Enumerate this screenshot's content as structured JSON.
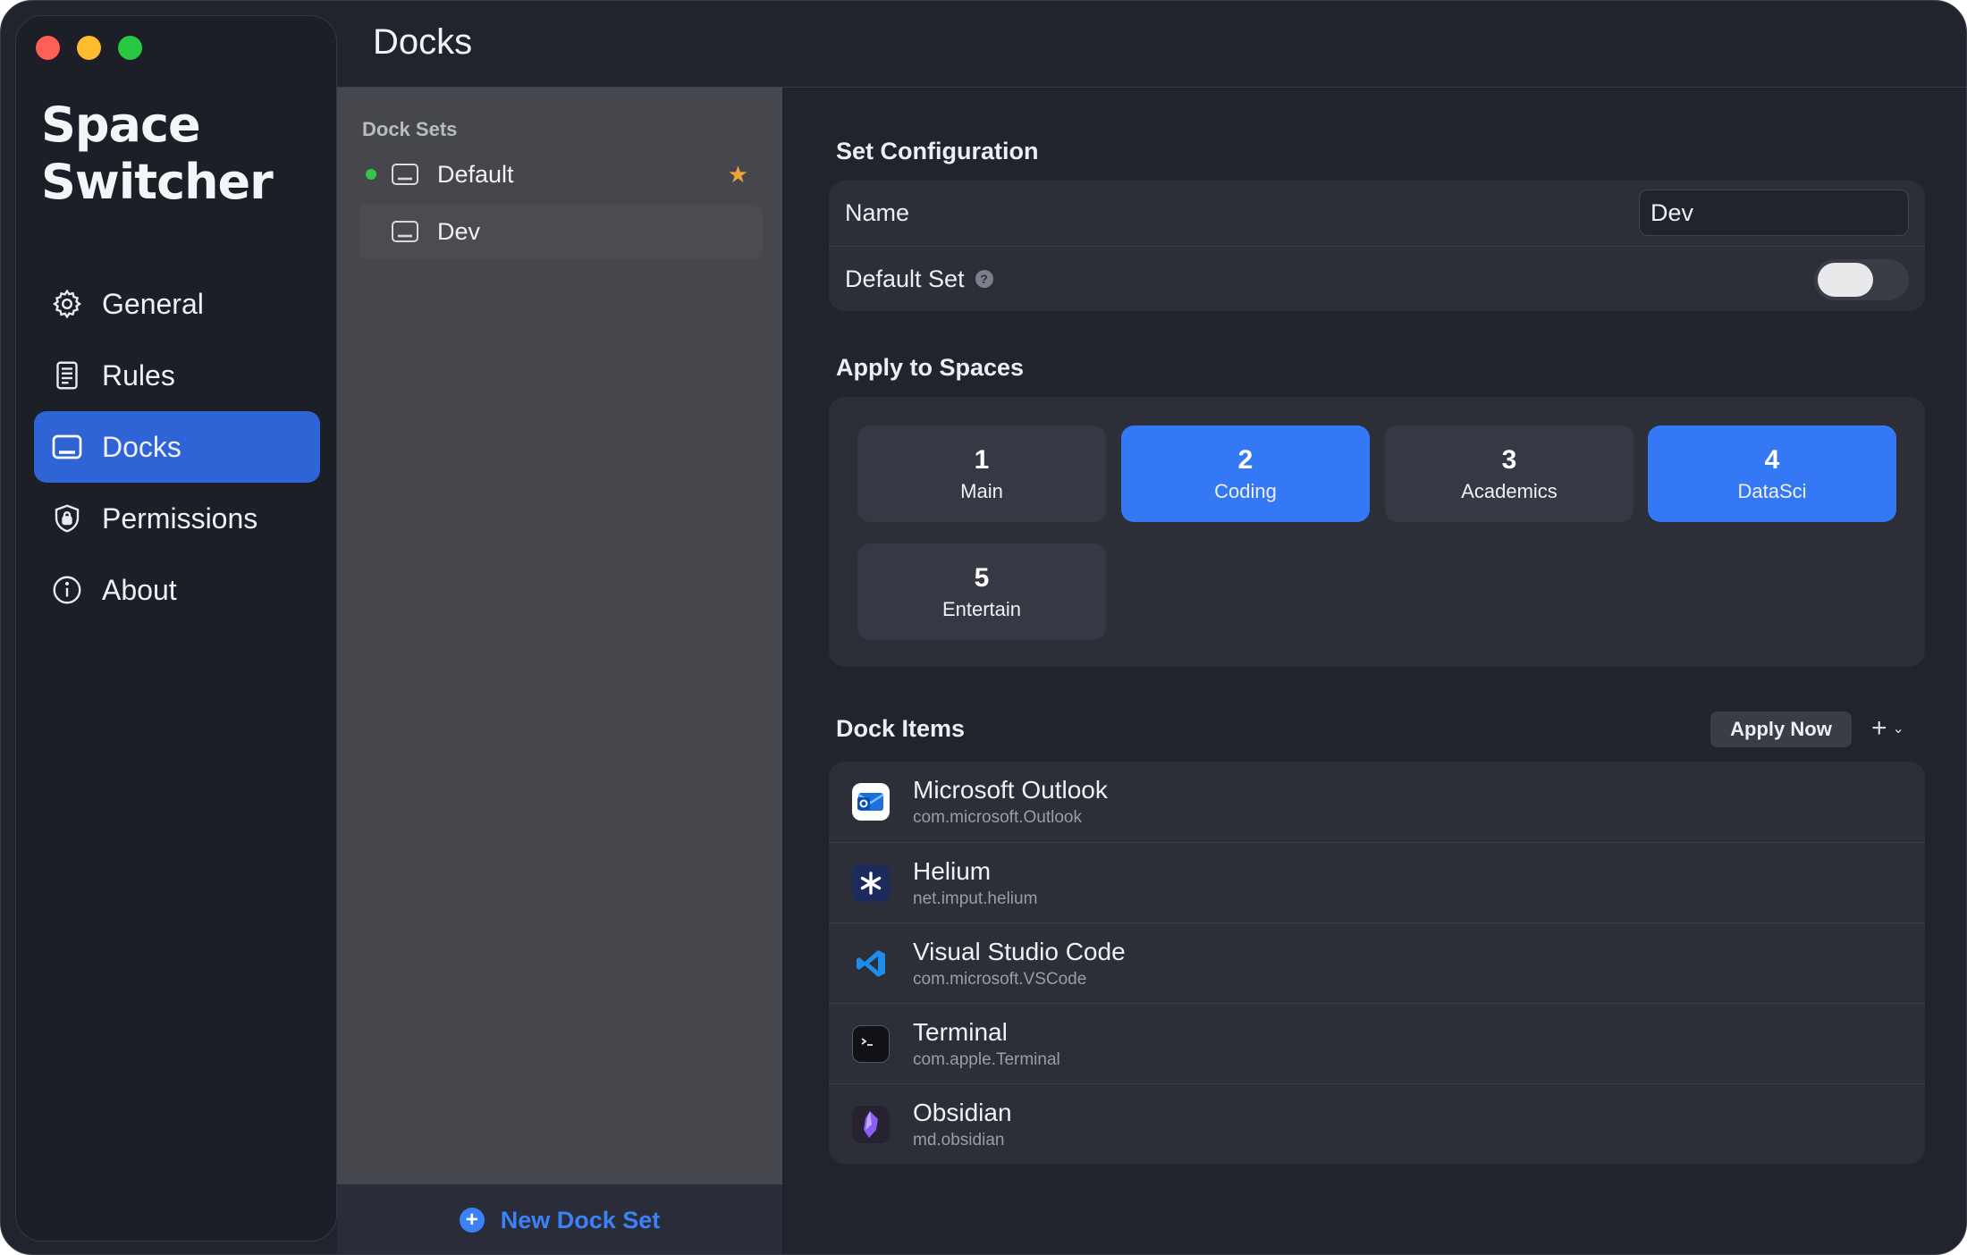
{
  "app": {
    "title": "Space Switcher",
    "title_line1": "Space",
    "title_line2": "Switcher"
  },
  "sidebar": {
    "items": [
      {
        "label": "General",
        "icon": "gear-icon",
        "active": false
      },
      {
        "label": "Rules",
        "icon": "document-icon",
        "active": false
      },
      {
        "label": "Docks",
        "icon": "dock-icon",
        "active": true
      },
      {
        "label": "Permissions",
        "icon": "shield-lock-icon",
        "active": false
      },
      {
        "label": "About",
        "icon": "info-icon",
        "active": false
      }
    ]
  },
  "header": {
    "title": "Docks"
  },
  "dock_sets": {
    "heading": "Dock Sets",
    "items": [
      {
        "label": "Default",
        "active_indicator": true,
        "is_default": true
      },
      {
        "label": "Dev",
        "active_indicator": false,
        "is_default": false,
        "selected": true
      }
    ],
    "new_button_label": "New Dock Set"
  },
  "config": {
    "section_title": "Set Configuration",
    "name_label": "Name",
    "name_value": "Dev",
    "default_label": "Default Set",
    "help_glyph": "?",
    "default_on": false
  },
  "spaces": {
    "section_title": "Apply to Spaces",
    "tiles": [
      {
        "num": "1",
        "label": "Main",
        "selected": false
      },
      {
        "num": "2",
        "label": "Coding",
        "selected": true
      },
      {
        "num": "3",
        "label": "Academics",
        "selected": false
      },
      {
        "num": "4",
        "label": "DataSci",
        "selected": true
      },
      {
        "num": "5",
        "label": "Entertain",
        "selected": false
      }
    ]
  },
  "dock_items": {
    "section_title": "Dock Items",
    "apply_label": "Apply Now",
    "add_glyph": "+",
    "items": [
      {
        "name": "Microsoft Outlook",
        "id": "com.microsoft.Outlook",
        "icon": "outlook-icon"
      },
      {
        "name": "Helium",
        "id": "net.imput.helium",
        "icon": "helium-icon"
      },
      {
        "name": "Visual Studio Code",
        "id": "com.microsoft.VSCode",
        "icon": "vscode-icon"
      },
      {
        "name": "Terminal",
        "id": "com.apple.Terminal",
        "icon": "terminal-icon"
      },
      {
        "name": "Obsidian",
        "id": "md.obsidian",
        "icon": "obsidian-icon"
      }
    ]
  },
  "colors": {
    "accent": "#3478f6",
    "sidebar_active": "#2f64d6",
    "active_dot": "#33c748",
    "star": "#f0a13a"
  }
}
